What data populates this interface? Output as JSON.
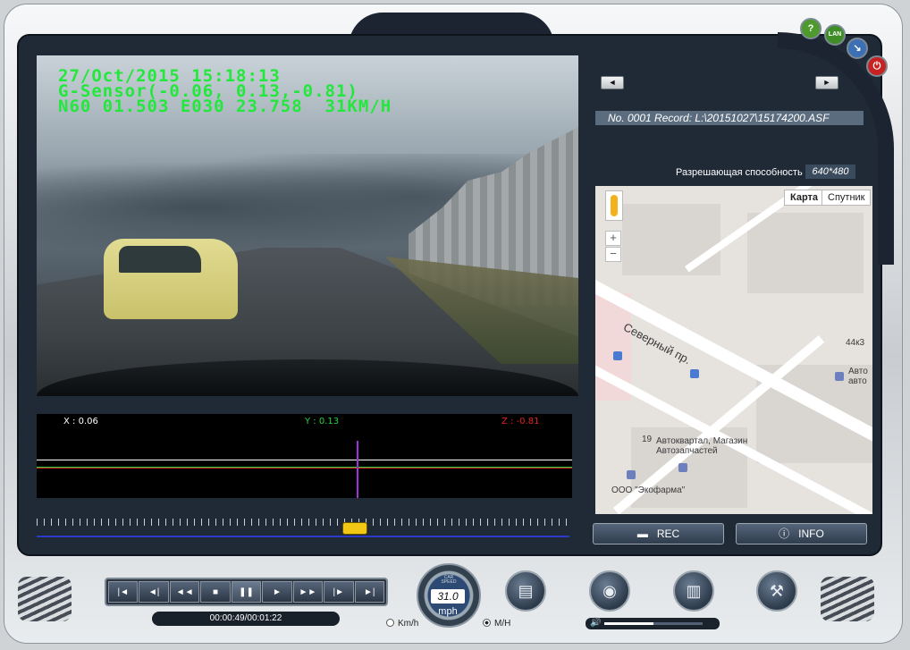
{
  "video": {
    "osd_line1": "27/Oct/2015 15:18:13",
    "osd_line2": "G-Sensor(-0.06, 0.13,-0.81)",
    "osd_line3": "N60 01.503 E030 23.758  31KM/H"
  },
  "gsensor": {
    "x_label": "X : 0.06",
    "y_label": "Y : 0.13",
    "z_label": "Z : -0.81",
    "colors": {
      "x": "#ffffff",
      "y": "#22d43a",
      "z": "#e02424"
    }
  },
  "playback": {
    "time": "00:00:49/00:01:22",
    "progress": 0.598
  },
  "nav": {
    "prev_icon": "◄",
    "next_icon": "►"
  },
  "record": {
    "info": "No.  0001 Record: L:\\20151027\\15174200.ASF"
  },
  "resolution": {
    "label": "Разрешающая способность",
    "value": "640*480"
  },
  "map": {
    "tab_map": "Карта",
    "tab_satellite": "Спутник",
    "zoom_in": "+",
    "zoom_out": "−",
    "street": "Северный пр.",
    "place1": "Автоквартал, Магазин",
    "place1_b": "Автозапчастей",
    "place2": "ООО \"Экофарма\"",
    "label_44k3": "44к3",
    "label_avto": "Авто",
    "label_avto2": "авто",
    "label_19": "19"
  },
  "buttons": {
    "rec": "REC",
    "info": "INFO",
    "help": "?",
    "lan": "LAN",
    "power": "⏻"
  },
  "controls": {
    "first": "|◄",
    "prev_frame": "◄|",
    "rewind": "◄◄",
    "stop": "■",
    "pause": "❚❚",
    "play": "►",
    "forward": "►►",
    "next_frame": "|►",
    "last": "►|"
  },
  "speed": {
    "caption": "CAR SPEED",
    "value": "31.0",
    "unit": "mph",
    "kmh_label": "Km/h",
    "mh_label": "M/H",
    "selected": "M/H"
  },
  "volume": {
    "level": 0.5
  }
}
